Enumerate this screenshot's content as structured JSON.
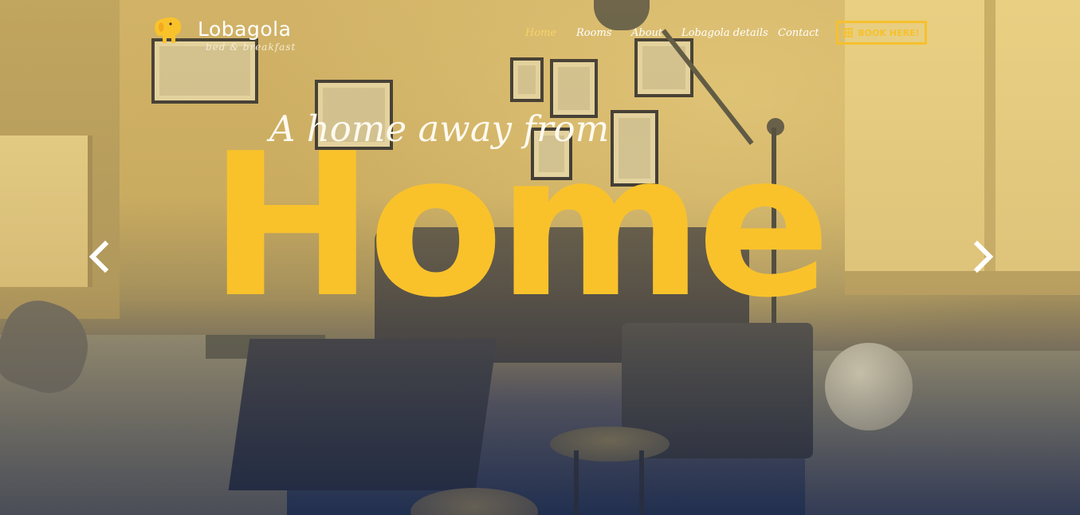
{
  "brand": {
    "name": "Lobagola",
    "tagline": "bed & breakfast"
  },
  "nav": {
    "items": [
      {
        "label": "Home",
        "active": true
      },
      {
        "label": "Rooms",
        "active": false
      },
      {
        "label": "About",
        "active": false
      },
      {
        "label": "Lobagola details",
        "active": false
      },
      {
        "label": "Contact",
        "active": false
      }
    ],
    "book_label": "BOOK HERE!"
  },
  "hero": {
    "subtitle": "A home away from",
    "headline": "Home"
  },
  "colors": {
    "accent": "#f9c22b",
    "nav_active": "#f6d36b",
    "text_light": "#ffffff"
  },
  "icons": {
    "logo": "elephant-icon",
    "book": "grid-icon",
    "prev": "chevron-left-icon",
    "next": "chevron-right-icon"
  }
}
